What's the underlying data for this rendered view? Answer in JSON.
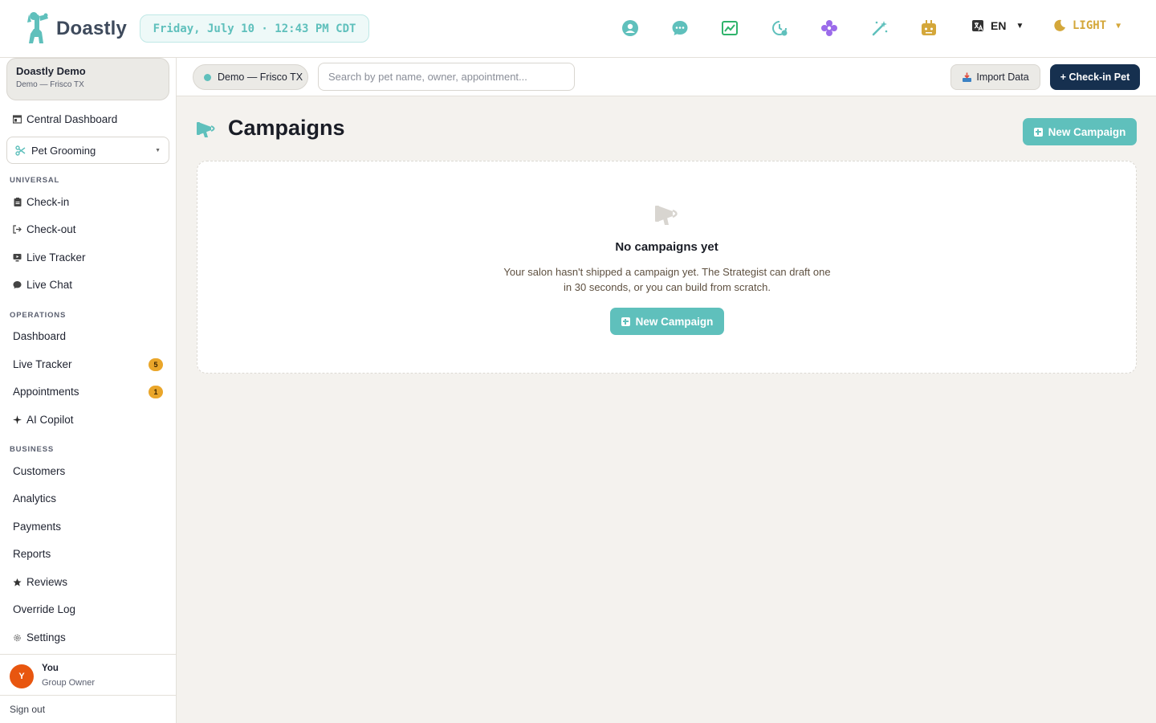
{
  "app": {
    "name": "Doastly"
  },
  "topbar": {
    "datetime": "Friday, July 10 · 12:43 PM CDT",
    "icons": [
      "support-icon",
      "chat-bubble-icon",
      "chart-image-icon",
      "clock-history-icon",
      "flower-icon",
      "magic-wand-icon",
      "robot-icon"
    ],
    "language": "EN",
    "theme": "LIGHT"
  },
  "sidebar": {
    "org_name": "Doastly Demo",
    "org_location": "Demo — Frisco TX",
    "central_dashboard": "Central Dashboard",
    "module": "Pet Grooming",
    "sections": {
      "universal": "UNIVERSAL",
      "operations": "OPERATIONS",
      "business": "BUSINESS"
    },
    "universal_items": [
      "Check-in",
      "Check-out",
      "Live Tracker",
      "Live Chat"
    ],
    "operations_items": [
      "Dashboard",
      "Live Tracker",
      "Appointments",
      "AI Copilot"
    ],
    "badges": {
      "live_tracker": "5",
      "appointments": "1"
    },
    "business_items": [
      "Customers",
      "Analytics",
      "Payments",
      "Reports",
      "Reviews",
      "Override Log",
      "Settings"
    ],
    "user": {
      "initial": "Y",
      "name": "You",
      "role": "Group Owner"
    },
    "sign_out": "Sign out"
  },
  "subbar": {
    "location": "Demo — Frisco TX",
    "search_placeholder": "Search by pet name, owner, appointment...",
    "import_label": "Import Data",
    "checkin_label": "+ Check-in Pet"
  },
  "main": {
    "title": "Campaigns",
    "new_campaign_label": "New Campaign",
    "empty": {
      "title": "No campaigns yet",
      "description": "Your salon hasn't shipped a campaign yet. The Strategist can draft one in 30 seconds, or you can build from scratch.",
      "button_label": "New Campaign"
    }
  },
  "colors": {
    "accent": "#5fc0bc",
    "navy": "#16304f",
    "badge": "#eaa62a",
    "avatar": "#e8560f",
    "theme": "#d4a73a"
  }
}
